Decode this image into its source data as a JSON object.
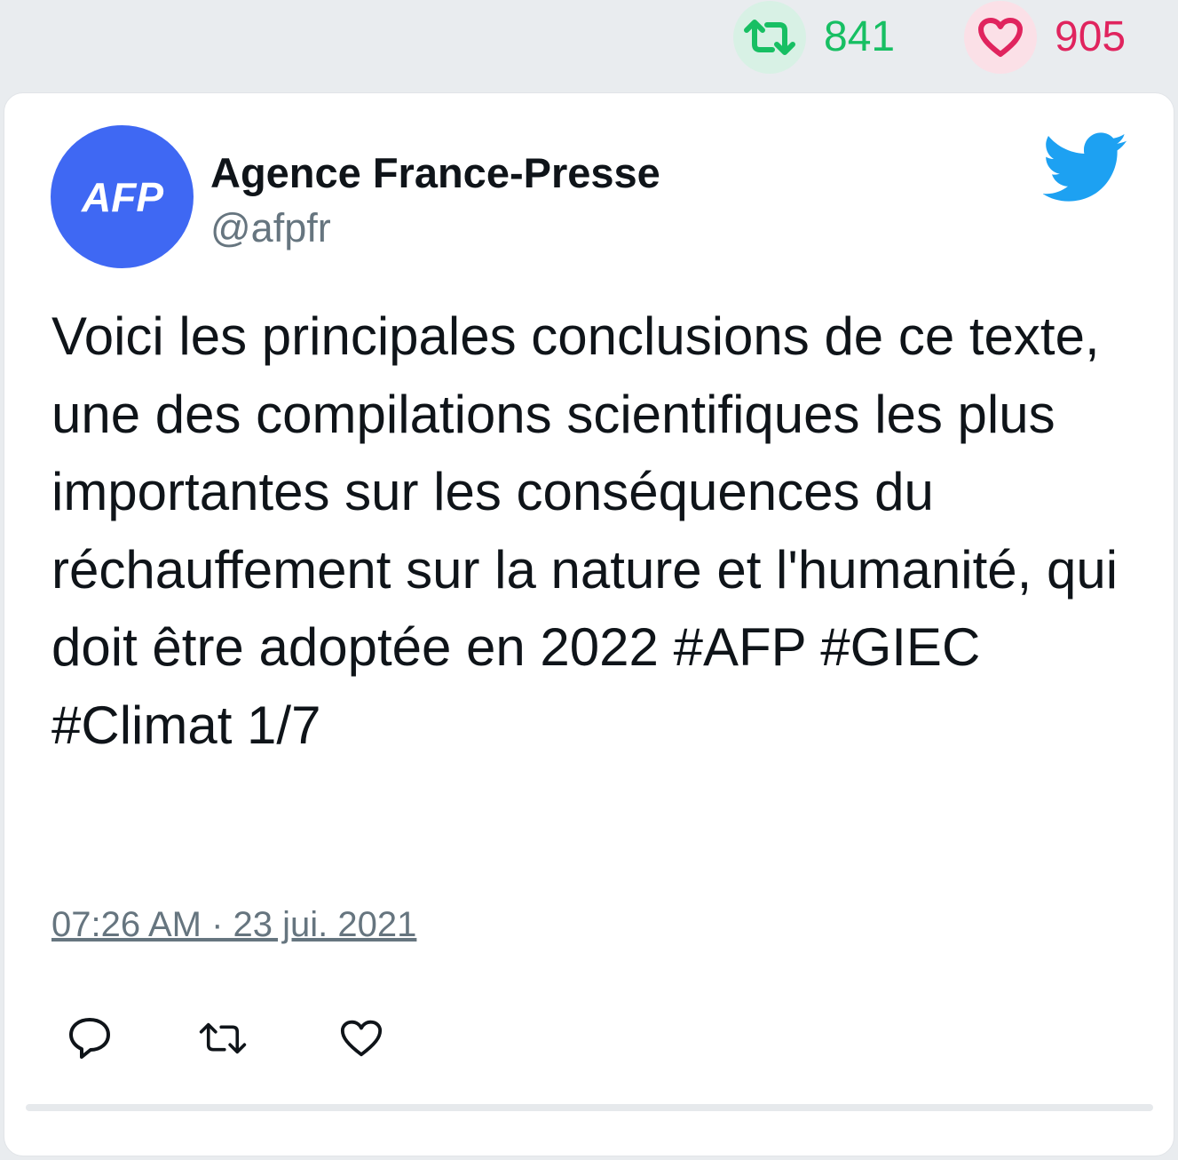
{
  "stats": {
    "retweets": "841",
    "likes": "905"
  },
  "author": {
    "name": "Agence France-Presse",
    "handle": "@afpfr",
    "avatar_text": "AFP"
  },
  "tweet": {
    "text": "Voici les principales conclusions de ce texte, une des compilations scientifiques les plus importantes sur les conséquences du réchauffement sur la nature et l'humanité, qui doit être adoptée en 2022 #AFP #GIEC #Climat 1/7",
    "timestamp": "07:26 AM · 23 jui. 2021"
  },
  "icons": {
    "retweet": "retweet-icon",
    "like": "heart-icon",
    "reply": "reply-icon",
    "brand": "twitter-bird-icon"
  },
  "colors": {
    "retweet": "#17bf63",
    "like": "#e0245e",
    "twitter_blue": "#1da1f2",
    "avatar_bg": "#3f68f3",
    "muted": "#66757f"
  }
}
